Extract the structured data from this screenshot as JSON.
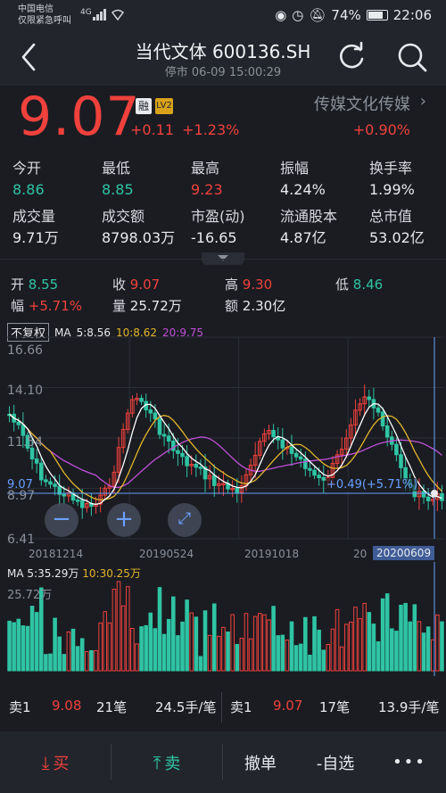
{
  "status_bar": {
    "carrier_line1": "中国电信",
    "carrier_line2": "仅限紧急呼叫",
    "network": "4G",
    "battery": "74%",
    "time": "22:06"
  },
  "header": {
    "title": "当代文体 600136.SH",
    "subtitle": "停市 06-09 15:00:29"
  },
  "quote": {
    "price": "9.07",
    "badge_rong": "融",
    "badge_lv": "LV2",
    "change": "+0.11",
    "change_pct": "+1.23%",
    "sector": "传媒文化传媒",
    "sector_change": "+0.90%"
  },
  "stats": [
    {
      "label": "今开",
      "value": "8.86",
      "color": "green"
    },
    {
      "label": "最低",
      "value": "8.85",
      "color": "green"
    },
    {
      "label": "最高",
      "value": "9.23",
      "color": "red"
    },
    {
      "label": "振幅",
      "value": "4.24%",
      "color": "white"
    },
    {
      "label": "换手率",
      "value": "1.99%",
      "color": "white"
    },
    {
      "label": "成交量",
      "value": "9.71万",
      "color": "white"
    },
    {
      "label": "成交额",
      "value": "8798.03万",
      "color": "white"
    },
    {
      "label": "市盈(动)",
      "value": "-16.65",
      "color": "white"
    },
    {
      "label": "流通股本",
      "value": "4.87亿",
      "color": "white"
    },
    {
      "label": "总市值",
      "value": "53.02亿",
      "color": "white"
    }
  ],
  "day_stats": {
    "open_label": "开",
    "open": "8.55",
    "close_label": "收",
    "close": "9.07",
    "high_label": "高",
    "high": "9.30",
    "low_label": "低",
    "low": "8.46",
    "amp_label": "幅",
    "amp": "+5.71%",
    "vol_label": "量",
    "vol": "25.72万",
    "amt_label": "额",
    "amt": "2.30亿"
  },
  "kline": {
    "adjust_label": "不复权",
    "ma_label": "MA",
    "ma5": "5:8.56",
    "ma10": "10:8.62",
    "ma20": "20:9.75",
    "y_ticks": [
      "16.66",
      "14.10",
      "11.54",
      "8.97",
      "6.41"
    ],
    "x_ticks": [
      "20181214",
      "20190524",
      "20191018",
      "20"
    ],
    "selected_date": "20200609",
    "crosshair_price": "9.07",
    "crosshair_pct": "+0.49(+5.71%)",
    "colors": {
      "up": "#f0413c",
      "down": "#2fc4a4",
      "ma5": "#ffffff",
      "ma10": "#e3b52a",
      "ma20": "#c24fd8",
      "crosshair": "#6aa0ff"
    }
  },
  "volume": {
    "ma_label": "MA",
    "ma5": "5:35.29万",
    "ma10": "10:30.25万",
    "max_label": "25.72万"
  },
  "order_book": {
    "side_label": "卖1",
    "price": "9.08",
    "orders": "21笔",
    "size": "24.5手/笔",
    "side_label_2": "卖1",
    "price_2": "9.07",
    "orders_2": "17笔",
    "size_2": "13.9手/笔"
  },
  "bottom_bar": {
    "buy": "买",
    "sell": "卖",
    "cancel": "撤单",
    "watch": "-自选",
    "more": "•••"
  }
}
